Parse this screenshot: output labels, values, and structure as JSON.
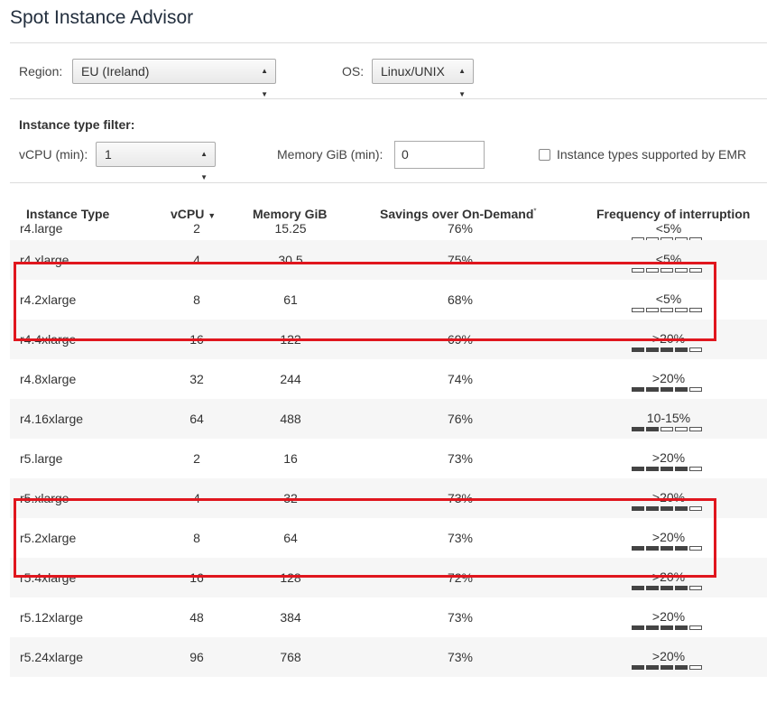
{
  "title": "Spot Instance Advisor",
  "region": {
    "label": "Region:",
    "value": "EU (Ireland)"
  },
  "os": {
    "label": "OS:",
    "value": "Linux/UNIX"
  },
  "filter": {
    "title": "Instance type filter:",
    "vcpu_label": "vCPU (min):",
    "vcpu_value": "1",
    "memory_label": "Memory GiB (min):",
    "memory_value": "0",
    "emr_label": "Instance types supported by EMR"
  },
  "table": {
    "headers": {
      "type": "Instance Type",
      "vcpu": "vCPU",
      "vcpu_sort_icon": "sort-desc",
      "memory": "Memory GiB",
      "savings": "Savings over On-Demand",
      "savings_note": "*",
      "frequency": "Frequency of interruption"
    },
    "rows": [
      {
        "type": "r4.large",
        "vcpu": "2",
        "memory": "15.25",
        "savings": "76%",
        "frequency": "<5%",
        "level": 0
      },
      {
        "type": "r4.xlarge",
        "vcpu": "4",
        "memory": "30.5",
        "savings": "75%",
        "frequency": "<5%",
        "level": 0
      },
      {
        "type": "r4.2xlarge",
        "vcpu": "8",
        "memory": "61",
        "savings": "68%",
        "frequency": "<5%",
        "level": 0
      },
      {
        "type": "r4.4xlarge",
        "vcpu": "16",
        "memory": "122",
        "savings": "69%",
        "frequency": ">20%",
        "level": 4
      },
      {
        "type": "r4.8xlarge",
        "vcpu": "32",
        "memory": "244",
        "savings": "74%",
        "frequency": ">20%",
        "level": 4
      },
      {
        "type": "r4.16xlarge",
        "vcpu": "64",
        "memory": "488",
        "savings": "76%",
        "frequency": "10-15%",
        "level": 2
      },
      {
        "type": "r5.large",
        "vcpu": "2",
        "memory": "16",
        "savings": "73%",
        "frequency": ">20%",
        "level": 4
      },
      {
        "type": "r5.xlarge",
        "vcpu": "4",
        "memory": "32",
        "savings": "73%",
        "frequency": ">20%",
        "level": 4
      },
      {
        "type": "r5.2xlarge",
        "vcpu": "8",
        "memory": "64",
        "savings": "73%",
        "frequency": ">20%",
        "level": 4
      },
      {
        "type": "r5.4xlarge",
        "vcpu": "16",
        "memory": "128",
        "savings": "72%",
        "frequency": ">20%",
        "level": 4
      },
      {
        "type": "r5.12xlarge",
        "vcpu": "48",
        "memory": "384",
        "savings": "73%",
        "frequency": ">20%",
        "level": 4
      },
      {
        "type": "r5.24xlarge",
        "vcpu": "96",
        "memory": "768",
        "savings": "73%",
        "frequency": ">20%",
        "level": 4
      }
    ]
  },
  "highlight_color": "#e0161e"
}
